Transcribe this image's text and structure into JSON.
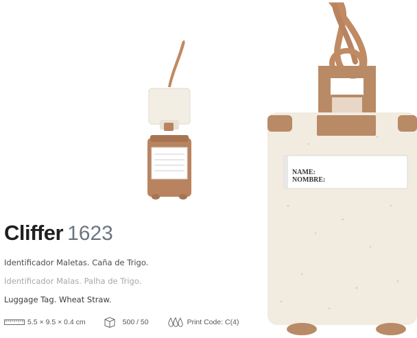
{
  "product": {
    "name": "Cliffer",
    "code": "1623",
    "desc_es": "Identificador Maletas. Caña de Trigo.",
    "desc_pt": "Identificador Malas. Palha de Trigo.",
    "desc_en": "Luggage Tag. Wheat Straw."
  },
  "specs": {
    "dimensions": "5.5 × 9.5 × 0.4 cm",
    "packaging": "500 / 50",
    "print_code": "Print Code: C(4)"
  },
  "tag_label": {
    "line1": "NAME:",
    "line2": "NOMBRE:"
  },
  "colors": {
    "strap": "#c08a63",
    "tag_body": "#f1ebe0",
    "accent": "#b98a66"
  }
}
